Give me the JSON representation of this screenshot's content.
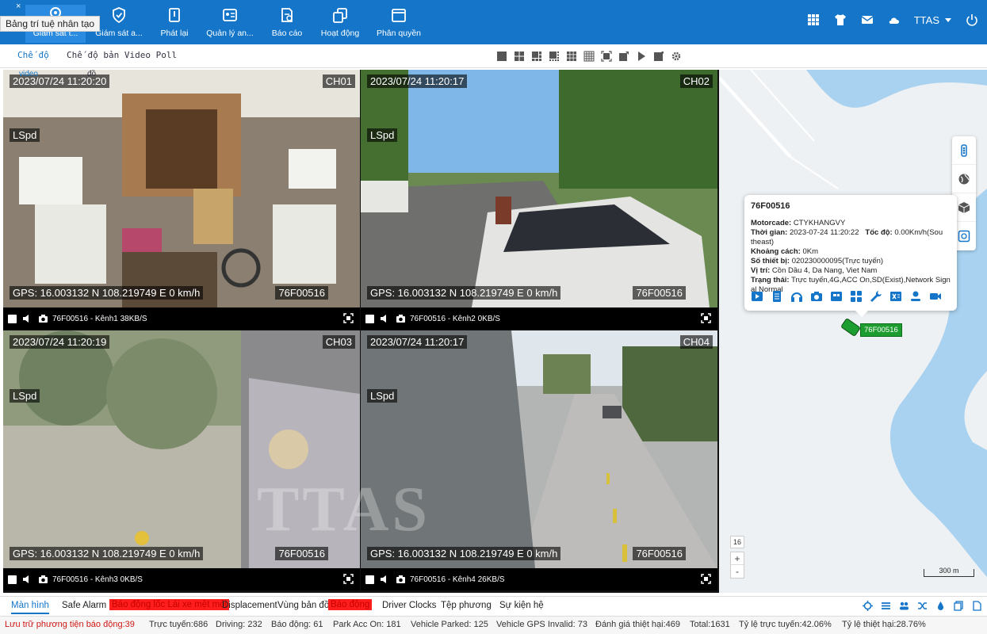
{
  "topbar": {
    "tooltip": "Bảng trí tuệ nhân tạo",
    "close_glyph": "×",
    "truncated_first": "Giám sát t...",
    "nav": [
      {
        "label": "Giám sát a...",
        "icon": "shield-icon"
      },
      {
        "label": "Phát lại",
        "icon": "playback-icon"
      },
      {
        "label": "Quản lý an...",
        "icon": "id-card-icon"
      },
      {
        "label": "Báo cáo",
        "icon": "report-icon"
      },
      {
        "label": "Hoạt động",
        "icon": "activity-icon"
      },
      {
        "label": "Phân quyền",
        "icon": "permission-icon"
      }
    ],
    "username": "TTAS"
  },
  "toolbar": {
    "mode_label": "Chế độ",
    "mode_video_label": "Chế độ bản Video Poll",
    "subtab_video": "video",
    "subtab_other": "đồ"
  },
  "channels": [
    {
      "timestamp": "2023/07/24   11:20:20",
      "channel": "CH01",
      "lspd": "LSpd",
      "gps": "GPS: 16.003132 N   108.219749 E     0 km/h",
      "plate": "76F00516",
      "caption": "76F00516 - Kênh1 38KB/S"
    },
    {
      "timestamp": "2023/07/24   11:20:17",
      "channel": "CH02",
      "lspd": "LSpd",
      "gps": "GPS: 16.003132 N   108.219749 E     0 km/h",
      "plate": "76F00516",
      "caption": "76F00516 - Kênh2 0KB/S"
    },
    {
      "timestamp": "2023/07/24   11:20:19",
      "channel": "CH03",
      "lspd": "LSpd",
      "gps": "GPS: 16.003132 N   108.219749 E     0 km/h",
      "plate": "76F00516",
      "caption": "76F00516 - Kênh3 0KB/S"
    },
    {
      "timestamp": "2023/07/24   11:20:17",
      "channel": "CH04",
      "lspd": "LSpd",
      "gps": "GPS: 16.003132 N   108.219749 E     0 km/h",
      "plate": "76F00516",
      "caption": "76F00516 - Kênh4 26KB/S"
    }
  ],
  "watermark": "TTAS",
  "map": {
    "popup": {
      "title": "76F00516",
      "motorcade_label": "Motorcade:",
      "motorcade": "CTYKHANGVY",
      "time_label": "Thời gian:",
      "time": "2023-07-24 11:20:22",
      "speed_label": "Tốc độ:",
      "speed": "0.00Km/h(Sou",
      "speed_cont": "theast)",
      "distance_label": "Khoảng cách:",
      "distance": "0Km",
      "device_label": "Số thiết bị:",
      "device": "020230000095(Trực tuyến)",
      "location_label": "Vị trí:",
      "location": "Cồn Dầu 4, Da Nang, Viet Nam",
      "status_label": "Trạng thái:",
      "status": "Trực tuyến,4G,ACC On,SD(Exist),Network Sign",
      "status_cont": "al Normal"
    },
    "vehicle_label": "76F00516",
    "zoom_level": "16",
    "zoom_in": "+",
    "zoom_out": "-",
    "scale": "300 m"
  },
  "tabs": [
    {
      "label": "Màn hình",
      "style": "active"
    },
    {
      "label": "Safe Alarm",
      "style": "normal"
    },
    {
      "label": "Báo động lốc Lái xe mệt mỏi",
      "style": "red"
    },
    {
      "label": "Displacement",
      "style": "normal"
    },
    {
      "label": "Vùng bản đồ",
      "style": "normal"
    },
    {
      "label": "Báo động",
      "style": "red"
    },
    {
      "label": "Driver Clocks",
      "style": "normal"
    },
    {
      "label": "Tệp phương",
      "style": "normal"
    },
    {
      "label": "Sự kiện hệ",
      "style": "normal"
    }
  ],
  "status": [
    "Lưu trữ phương tiện báo động:39",
    "Trực tuyến:686",
    "Driving: 232",
    "Báo động: 61",
    "Park Acc On: 181",
    "Vehicle Parked: 125",
    "Vehicle GPS Invalid: 73",
    "Đánh giá thiệt hại:469",
    "Total:1631",
    "Tỷ lệ trực tuyến:42.06%",
    "Tỷ lệ thiệt hại:28.76%"
  ],
  "colors": {
    "primary": "#1475c9",
    "alarm_red": "#ff1e1e",
    "vehicle_green": "#1d9c2f"
  }
}
